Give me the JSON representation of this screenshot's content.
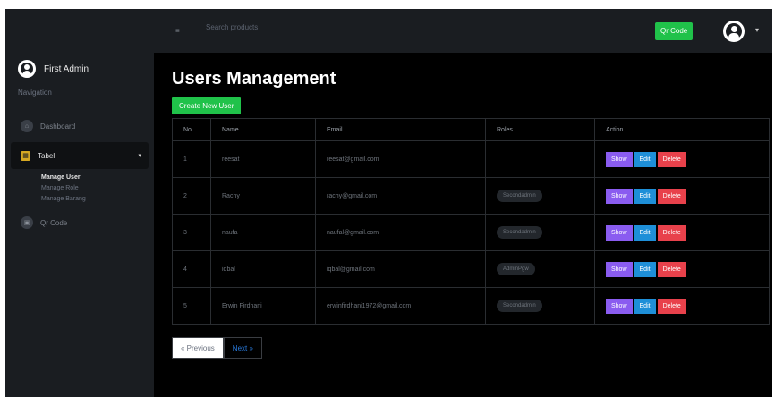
{
  "sidebar": {
    "user_name": "First Admin",
    "nav_caption": "Navigation",
    "items": [
      {
        "label": "Dashboard",
        "icon": "home-icon"
      },
      {
        "label": "Tabel",
        "icon": "table-icon"
      },
      {
        "label": "Qr Code",
        "icon": "qr-icon"
      }
    ],
    "submenu": [
      "Manage User",
      "Manage Role",
      "Manage Barang"
    ]
  },
  "topbar": {
    "search_placeholder": "Search products",
    "qr_button": "Qr Code",
    "menu_icon": "hamburger-icon",
    "profile_icon": "user-circle-icon"
  },
  "main": {
    "title": "Users Management",
    "create_button": "Create New User",
    "columns": [
      "No",
      "Name",
      "Email",
      "Roles",
      "Action"
    ],
    "rows": [
      {
        "no": "1",
        "name": "reesat",
        "email": "reesat@gmail.com",
        "role": ""
      },
      {
        "no": "2",
        "name": "Rachy",
        "email": "rachy@gmail.com",
        "role": "Secondadmin"
      },
      {
        "no": "3",
        "name": "naufa",
        "email": "naufal@gmail.com",
        "role": "Secondadmin"
      },
      {
        "no": "4",
        "name": "iqbal",
        "email": "iqbal@gmail.com",
        "role": "AdminPgw"
      },
      {
        "no": "5",
        "name": "Erwin Firdhani",
        "email": "erwinfirdhani1972@gmail.com",
        "role": "Secondadmin"
      }
    ],
    "actions": {
      "show": "Show",
      "edit": "Edit",
      "delete": "Delete"
    },
    "pagination": {
      "prev": "« Previous",
      "next": "Next »"
    }
  },
  "colors": {
    "green": "#20c24a",
    "show": "#8a5cf0",
    "edit": "#1e8fd8",
    "delete": "#e8414b",
    "sidebar_bg": "#1a1d21"
  }
}
